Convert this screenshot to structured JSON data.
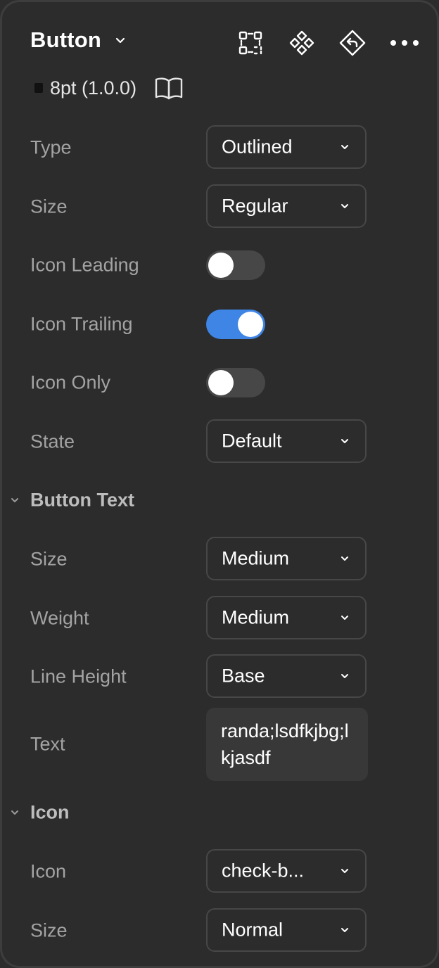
{
  "header": {
    "title": "Button",
    "icons": [
      "component-outline-icon",
      "component-instance-icon",
      "reset-instance-icon",
      "more-options-icon"
    ]
  },
  "library": {
    "name": "8pt (1.0.0)",
    "icon": "book-icon"
  },
  "properties": {
    "type": {
      "label": "Type",
      "value": "Outlined"
    },
    "size": {
      "label": "Size",
      "value": "Regular"
    },
    "icon_leading": {
      "label": "Icon Leading",
      "on": false
    },
    "icon_trailing": {
      "label": "Icon Trailing",
      "on": true
    },
    "icon_only": {
      "label": "Icon Only",
      "on": false
    },
    "state": {
      "label": "State",
      "value": "Default"
    }
  },
  "button_text": {
    "title": "Button Text",
    "size": {
      "label": "Size",
      "value": "Medium"
    },
    "weight": {
      "label": "Weight",
      "value": "Medium"
    },
    "line_height": {
      "label": "Line Height",
      "value": "Base"
    },
    "text": {
      "label": "Text",
      "value": "randa;lsdfkjbg;lkjasdf"
    }
  },
  "icon_section": {
    "title": "Icon",
    "icon": {
      "label": "Icon",
      "value": "check-b..."
    },
    "size": {
      "label": "Size",
      "value": "Normal"
    }
  },
  "colors": {
    "background": "#2c2c2c",
    "toggle_on": "#3e85e6",
    "toggle_off": "#474747",
    "label": "#a3a3a3"
  }
}
